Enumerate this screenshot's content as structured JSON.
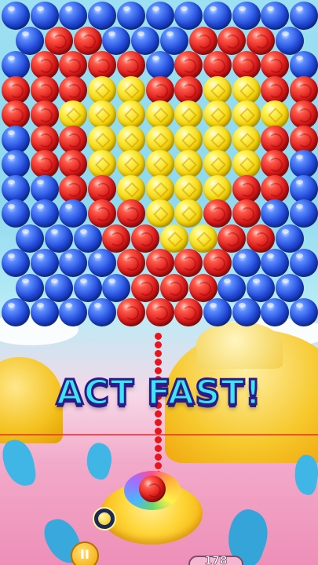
{
  "banner": {
    "text": "ACT FAST!"
  },
  "hud": {
    "shots_remaining": "178",
    "pause_icon": "pause-icon"
  },
  "launcher": {
    "current_bubble": "red",
    "next_bubble": "yellow"
  },
  "colors": {
    "blue": "#1f47d6",
    "red": "#d81818",
    "yellow": "#f2cf05",
    "aim_line": "#e8141e",
    "banner_fill": "#3de5f0",
    "banner_outline": "#2b1a8a"
  },
  "board": {
    "rows": [
      "BBBBBBBBBBB",
      "BRRBBBRRRB",
      "BRRRRBRRRRB",
      "RRRYYRRYYRR",
      "RRYYYYYYYYR",
      "BRRYYYYYYRR",
      "BRRYYYYYYRB",
      "BBRRYYYYRRB",
      "BBBRRYYRRBB",
      "BBBRRYYRRB",
      "BBBBRRRRBBB",
      "BBBBRRRBBB",
      "BBBBRRRBBBB"
    ]
  }
}
